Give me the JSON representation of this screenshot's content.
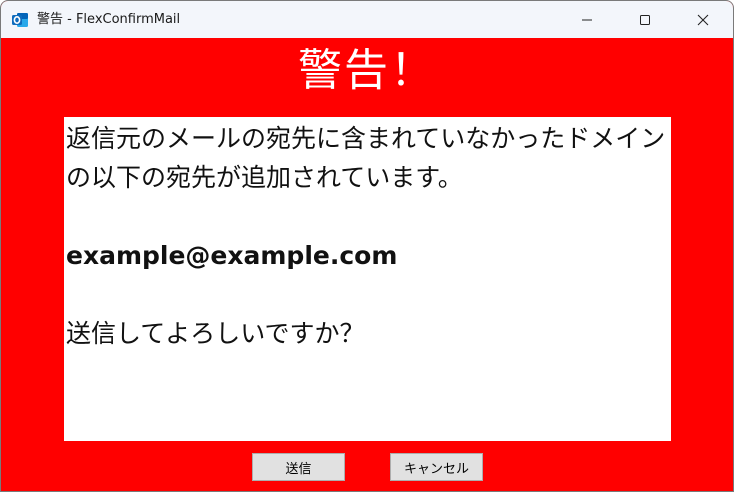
{
  "window": {
    "title": "警告 - FlexConfirmMail",
    "icon": "outlook-icon",
    "controls": [
      "minimize-icon",
      "maximize-icon",
      "close-icon"
    ]
  },
  "dialog": {
    "heading": "警告！",
    "message_line1": "返信元のメールの宛先に含まれていなかったドメイン",
    "message_line2": "の以下の宛先が追加されています。",
    "email": "example@example.com",
    "confirm": "送信してよろしいですか？",
    "send_label": "送信",
    "cancel_label": "キャンセル"
  },
  "colors": {
    "background": "#ff0000",
    "heading_text": "#ffffff",
    "message_bg": "#ffffff",
    "titlebar": "#f3f6fb",
    "outlook_blue": "#0f6cbd"
  }
}
